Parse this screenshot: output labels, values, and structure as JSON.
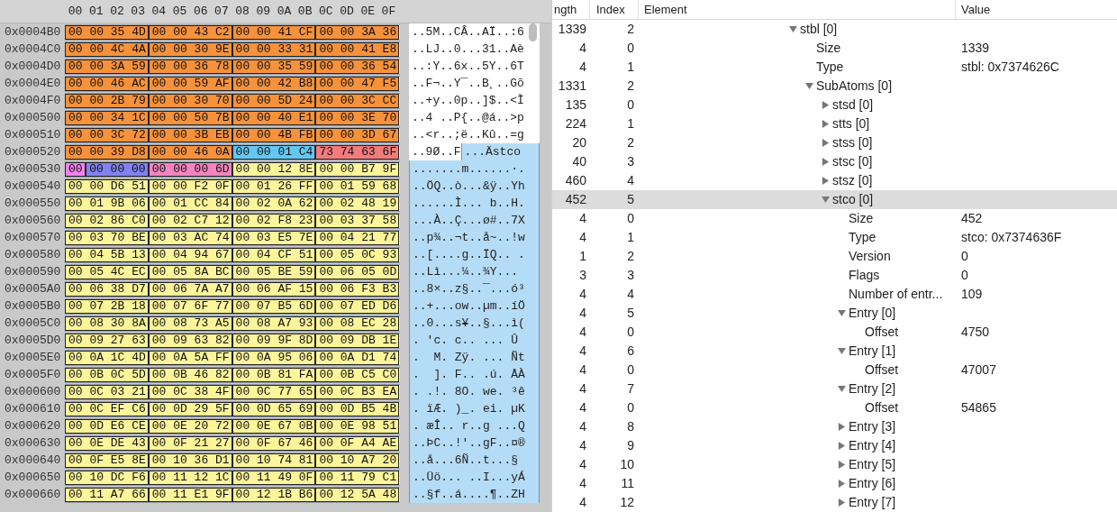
{
  "hex_view": {
    "columns": [
      "00",
      "01",
      "02",
      "03",
      "04",
      "05",
      "06",
      "07",
      "08",
      "09",
      "0A",
      "0B",
      "0C",
      "0D",
      "0E",
      "0F"
    ],
    "rows": [
      {
        "address": "0x0004B0",
        "segments": [
          {
            "bytes": "00 00 35 4D",
            "color": "#f7923a"
          },
          {
            "bytes": "00 00 43 C2",
            "color": "#f7923a"
          },
          {
            "bytes": "00 00 41 CF",
            "color": "#f7923a"
          },
          {
            "bytes": "00 00 3A 36",
            "color": "#f7923a"
          }
        ],
        "ascii": [
          {
            "text": "..5M..CÂ..AÏ..:6",
            "highlighted": false
          }
        ]
      },
      {
        "address": "0x0004C0",
        "segments": [
          {
            "bytes": "00 00 4C 4A",
            "color": "#f7923a"
          },
          {
            "bytes": "00 00 30 9E",
            "color": "#f7923a"
          },
          {
            "bytes": "00 00 33 31",
            "color": "#f7923a"
          },
          {
            "bytes": "00 00 41 E8",
            "color": "#f7923a"
          }
        ],
        "ascii": [
          {
            "text": "..LJ..0...31..Aè",
            "highlighted": false
          }
        ]
      },
      {
        "address": "0x0004D0",
        "segments": [
          {
            "bytes": "00 00 3A 59",
            "color": "#f7923a"
          },
          {
            "bytes": "00 00 36 78",
            "color": "#f7923a"
          },
          {
            "bytes": "00 00 35 59",
            "color": "#f7923a"
          },
          {
            "bytes": "00 00 36 54",
            "color": "#f7923a"
          }
        ],
        "ascii": [
          {
            "text": "..:Y..6x..5Y..6T",
            "highlighted": false
          }
        ]
      },
      {
        "address": "0x0004E0",
        "segments": [
          {
            "bytes": "00 00 46 AC",
            "color": "#f7923a"
          },
          {
            "bytes": "00 00 59 AF",
            "color": "#f7923a"
          },
          {
            "bytes": "00 00 42 B8",
            "color": "#f7923a"
          },
          {
            "bytes": "00 00 47 F5",
            "color": "#f7923a"
          }
        ],
        "ascii": [
          {
            "text": "..F¬..Y¯..B¸..Gõ",
            "highlighted": false
          }
        ]
      },
      {
        "address": "0x0004F0",
        "segments": [
          {
            "bytes": "00 00 2B 79",
            "color": "#f7923a"
          },
          {
            "bytes": "00 00 30 70",
            "color": "#f7923a"
          },
          {
            "bytes": "00 00 5D 24",
            "color": "#f7923a"
          },
          {
            "bytes": "00 00 3C CC",
            "color": "#f7923a"
          }
        ],
        "ascii": [
          {
            "text": "..+y..0p..]$..<Ì",
            "highlighted": false
          }
        ]
      },
      {
        "address": "0x000500",
        "segments": [
          {
            "bytes": "00 00 34 1C",
            "color": "#f7923a"
          },
          {
            "bytes": "00 00 50 7B",
            "color": "#f7923a"
          },
          {
            "bytes": "00 00 40 E1",
            "color": "#f7923a"
          },
          {
            "bytes": "00 00 3E 70",
            "color": "#f7923a"
          }
        ],
        "ascii": [
          {
            "text": "..4 ..P{..@á..>p",
            "highlighted": false
          }
        ]
      },
      {
        "address": "0x000510",
        "segments": [
          {
            "bytes": "00 00 3C 72",
            "color": "#f7923a"
          },
          {
            "bytes": "00 00 3B EB",
            "color": "#f7923a"
          },
          {
            "bytes": "00 00 4B FB",
            "color": "#f7923a"
          },
          {
            "bytes": "00 00 3D 67",
            "color": "#f7923a"
          }
        ],
        "ascii": [
          {
            "text": "..<r..;ë..Kû..=g",
            "highlighted": false
          }
        ]
      },
      {
        "address": "0x000520",
        "segments": [
          {
            "bytes": "00 00 39 D8",
            "color": "#f7923a"
          },
          {
            "bytes": "00 00 46 0A",
            "color": "#f7923a"
          },
          {
            "bytes": "00 00 01 C4",
            "color": "#62c8f3"
          },
          {
            "bytes": "73 74 63 6F",
            "color": "#f37b7d"
          }
        ],
        "ascii": [
          {
            "text": "..9Ø..F",
            "highlighted": false
          },
          {
            "text": "...Ästco",
            "highlighted": true
          }
        ]
      },
      {
        "address": "0x000530",
        "segments": [
          {
            "bytes": "00",
            "color": "#f383f0"
          },
          {
            "bytes": "00 00 00",
            "color": "#8282f0"
          },
          {
            "bytes": "00 00 00 6D",
            "color": "#f285c0"
          },
          {
            "bytes": "00 00 12 8E",
            "color": "#fdf59a"
          },
          {
            "bytes": "00 00 B7 9F",
            "color": "#fdf59a"
          }
        ],
        "ascii": [
          {
            "text": ".......m......·.",
            "highlighted": true
          }
        ]
      },
      {
        "address": "0x000540",
        "segments": [
          {
            "bytes": "00 00 D6 51",
            "color": "#fdf59a"
          },
          {
            "bytes": "00 00 F2 0F",
            "color": "#fdf59a"
          },
          {
            "bytes": "00 01 26 FF",
            "color": "#fdf59a"
          },
          {
            "bytes": "00 01 59 68",
            "color": "#fdf59a"
          }
        ],
        "ascii": [
          {
            "text": "..ÖQ..ò...&ÿ..Yh",
            "highlighted": true
          }
        ]
      },
      {
        "address": "0x000550",
        "segments": [
          {
            "bytes": "00 01 9B 06",
            "color": "#fdf59a"
          },
          {
            "bytes": "00 01 CC 84",
            "color": "#fdf59a"
          },
          {
            "bytes": "00 02 0A 62",
            "color": "#fdf59a"
          },
          {
            "bytes": "00 02 48 19",
            "color": "#fdf59a"
          }
        ],
        "ascii": [
          {
            "text": "......Ì... b..H.",
            "highlighted": true
          }
        ]
      },
      {
        "address": "0x000560",
        "segments": [
          {
            "bytes": "00 02 86 C0",
            "color": "#fdf59a"
          },
          {
            "bytes": "00 02 C7 12",
            "color": "#fdf59a"
          },
          {
            "bytes": "00 02 F8 23",
            "color": "#fdf59a"
          },
          {
            "bytes": "00 03 37 58",
            "color": "#fdf59a"
          }
        ],
        "ascii": [
          {
            "text": "...À..Ç...ø#..7X",
            "highlighted": true
          }
        ]
      },
      {
        "address": "0x000570",
        "segments": [
          {
            "bytes": "00 03 70 BE",
            "color": "#fdf59a"
          },
          {
            "bytes": "00 03 AC 74",
            "color": "#fdf59a"
          },
          {
            "bytes": "00 03 E5 7E",
            "color": "#fdf59a"
          },
          {
            "bytes": "00 04 21 77",
            "color": "#fdf59a"
          }
        ],
        "ascii": [
          {
            "text": "..p¾..¬t..å~..!w",
            "highlighted": true
          }
        ]
      },
      {
        "address": "0x000580",
        "segments": [
          {
            "bytes": "00 04 5B 13",
            "color": "#fdf59a"
          },
          {
            "bytes": "00 04 94 67",
            "color": "#fdf59a"
          },
          {
            "bytes": "00 04 CF 51",
            "color": "#fdf59a"
          },
          {
            "bytes": "00 05 0C 93",
            "color": "#fdf59a"
          }
        ],
        "ascii": [
          {
            "text": "..[....g..ÏQ.. .",
            "highlighted": true
          }
        ]
      },
      {
        "address": "0x000590",
        "segments": [
          {
            "bytes": "00 05 4C EC",
            "color": "#fdf59a"
          },
          {
            "bytes": "00 05 8A BC",
            "color": "#fdf59a"
          },
          {
            "bytes": "00 05 BE 59",
            "color": "#fdf59a"
          },
          {
            "bytes": "00 06 05 0D",
            "color": "#fdf59a"
          }
        ],
        "ascii": [
          {
            "text": "..Lì...¼..¾Y...",
            "highlighted": true
          }
        ]
      },
      {
        "address": "0x0005A0",
        "segments": [
          {
            "bytes": "00 06 38 D7",
            "color": "#fdf59a"
          },
          {
            "bytes": "00 06 7A A7",
            "color": "#fdf59a"
          },
          {
            "bytes": "00 06 AF 15",
            "color": "#fdf59a"
          },
          {
            "bytes": "00 06 F3 B3",
            "color": "#fdf59a"
          }
        ],
        "ascii": [
          {
            "text": "..8×..z§..¯...ó³",
            "highlighted": true
          }
        ]
      },
      {
        "address": "0x0005B0",
        "segments": [
          {
            "bytes": "00 07 2B 18",
            "color": "#fdf59a"
          },
          {
            "bytes": "00 07 6F 77",
            "color": "#fdf59a"
          },
          {
            "bytes": "00 07 B5 6D",
            "color": "#fdf59a"
          },
          {
            "bytes": "00 07 ED D6",
            "color": "#fdf59a"
          }
        ],
        "ascii": [
          {
            "text": "..+...ow..µm..íÖ",
            "highlighted": true
          }
        ]
      },
      {
        "address": "0x0005C0",
        "segments": [
          {
            "bytes": "00 08 30 8A",
            "color": "#fdf59a"
          },
          {
            "bytes": "00 08 73 A5",
            "color": "#fdf59a"
          },
          {
            "bytes": "00 08 A7 93",
            "color": "#fdf59a"
          },
          {
            "bytes": "00 08 EC 28",
            "color": "#fdf59a"
          }
        ],
        "ascii": [
          {
            "text": "..0...s¥..§...ì(",
            "highlighted": true
          }
        ]
      },
      {
        "address": "0x0005D0",
        "segments": [
          {
            "bytes": "00 09 27 63",
            "color": "#fdf59a"
          },
          {
            "bytes": "00 09 63 82",
            "color": "#fdf59a"
          },
          {
            "bytes": "00 09 9F 8D",
            "color": "#fdf59a"
          },
          {
            "bytes": "00 09 DB 1E",
            "color": "#fdf59a"
          }
        ],
        "ascii": [
          {
            "text": ". 'c. c.. ... Û",
            "highlighted": true
          }
        ]
      },
      {
        "address": "0x0005E0",
        "segments": [
          {
            "bytes": "00 0A 1C 4D",
            "color": "#fdf59a"
          },
          {
            "bytes": "00 0A 5A FF",
            "color": "#fdf59a"
          },
          {
            "bytes": "00 0A 95 06",
            "color": "#fdf59a"
          },
          {
            "bytes": "00 0A D1 74",
            "color": "#fdf59a"
          }
        ],
        "ascii": [
          {
            "text": ".  M. Zÿ. ... Ñt",
            "highlighted": true
          }
        ]
      },
      {
        "address": "0x0005F0",
        "segments": [
          {
            "bytes": "00 0B 0C 5D",
            "color": "#fdf59a"
          },
          {
            "bytes": "00 0B 46 82",
            "color": "#fdf59a"
          },
          {
            "bytes": "00 0B 81 FA",
            "color": "#fdf59a"
          },
          {
            "bytes": "00 0B C5 C0",
            "color": "#fdf59a"
          }
        ],
        "ascii": [
          {
            "text": ".  ]. F.. .ú. ÅÀ",
            "highlighted": true
          }
        ]
      },
      {
        "address": "0x000600",
        "segments": [
          {
            "bytes": "00 0C 03 21",
            "color": "#fdf59a"
          },
          {
            "bytes": "00 0C 38 4F",
            "color": "#fdf59a"
          },
          {
            "bytes": "00 0C 77 65",
            "color": "#fdf59a"
          },
          {
            "bytes": "00 0C B3 EA",
            "color": "#fdf59a"
          }
        ],
        "ascii": [
          {
            "text": ". .!. 8O. we. ³ê",
            "highlighted": true
          }
        ]
      },
      {
        "address": "0x000610",
        "segments": [
          {
            "bytes": "00 0C EF C6",
            "color": "#fdf59a"
          },
          {
            "bytes": "00 0D 29 5F",
            "color": "#fdf59a"
          },
          {
            "bytes": "00 0D 65 69",
            "color": "#fdf59a"
          },
          {
            "bytes": "00 0D B5 4B",
            "color": "#fdf59a"
          }
        ],
        "ascii": [
          {
            "text": ". ïÆ. )_. ei. µK",
            "highlighted": true
          }
        ]
      },
      {
        "address": "0x000620",
        "segments": [
          {
            "bytes": "00 0D E6 CE",
            "color": "#fdf59a"
          },
          {
            "bytes": "00 0E 20 72",
            "color": "#fdf59a"
          },
          {
            "bytes": "00 0E 67 0B",
            "color": "#fdf59a"
          },
          {
            "bytes": "00 0E 98 51",
            "color": "#fdf59a"
          }
        ],
        "ascii": [
          {
            "text": ". æÎ.. r..g ...Q",
            "highlighted": true
          }
        ]
      },
      {
        "address": "0x000630",
        "segments": [
          {
            "bytes": "00 0E DE 43",
            "color": "#fdf59a"
          },
          {
            "bytes": "00 0F 21 27",
            "color": "#fdf59a"
          },
          {
            "bytes": "00 0F 67 46",
            "color": "#fdf59a"
          },
          {
            "bytes": "00 0F A4 AE",
            "color": "#fdf59a"
          }
        ],
        "ascii": [
          {
            "text": "..ÞC..!'..gF..¤®",
            "highlighted": true
          }
        ]
      },
      {
        "address": "0x000640",
        "segments": [
          {
            "bytes": "00 0F E5 8E",
            "color": "#fdf59a"
          },
          {
            "bytes": "00 10 36 D1",
            "color": "#fdf59a"
          },
          {
            "bytes": "00 10 74 81",
            "color": "#fdf59a"
          },
          {
            "bytes": "00 10 A7 20",
            "color": "#fdf59a"
          }
        ],
        "ascii": [
          {
            "text": "..å...6Ñ..t...§",
            "highlighted": true
          }
        ]
      },
      {
        "address": "0x000650",
        "segments": [
          {
            "bytes": "00 10 DC F6",
            "color": "#fdf59a"
          },
          {
            "bytes": "00 11 12 1C",
            "color": "#fdf59a"
          },
          {
            "bytes": "00 11 49 0F",
            "color": "#fdf59a"
          },
          {
            "bytes": "00 11 79 C1",
            "color": "#fdf59a"
          }
        ],
        "ascii": [
          {
            "text": "..Üö... ..I...yÁ",
            "highlighted": true
          }
        ]
      },
      {
        "address": "0x000660",
        "segments": [
          {
            "bytes": "00 11 A7 66",
            "color": "#fdf59a"
          },
          {
            "bytes": "00 11 E1 9F",
            "color": "#fdf59a"
          },
          {
            "bytes": "00 12 1B B6",
            "color": "#fdf59a"
          },
          {
            "bytes": "00 12 5A 48",
            "color": "#fdf59a"
          }
        ],
        "ascii": [
          {
            "text": "..§f..á....¶..ZH",
            "highlighted": true
          }
        ]
      }
    ]
  },
  "structure_view": {
    "columns": [
      "ngth",
      "Index",
      "Element",
      "Value"
    ],
    "tree": [
      {
        "length": "1339",
        "index": "2",
        "label": "stbl [0]",
        "expanded": true,
        "selected": false,
        "children": [
          {
            "length": "4",
            "index": "0",
            "label": "Size",
            "value": "1339",
            "selected": false
          },
          {
            "length": "4",
            "index": "1",
            "label": "Type",
            "value": "stbl: 0x7374626C",
            "selected": false
          },
          {
            "length": "1331",
            "index": "2",
            "label": "SubAtoms [0]",
            "expanded": true,
            "selected": false,
            "children": [
              {
                "length": "135",
                "index": "0",
                "label": "stsd [0]",
                "expanded": false,
                "selected": false
              },
              {
                "length": "224",
                "index": "1",
                "label": "stts [0]",
                "expanded": false,
                "selected": false
              },
              {
                "length": "20",
                "index": "2",
                "label": "stss [0]",
                "expanded": false,
                "selected": false
              },
              {
                "length": "40",
                "index": "3",
                "label": "stsc [0]",
                "expanded": false,
                "selected": false
              },
              {
                "length": "460",
                "index": "4",
                "label": "stsz [0]",
                "expanded": false,
                "selected": false
              },
              {
                "length": "452",
                "index": "5",
                "label": "stco [0]",
                "expanded": true,
                "selected": true,
                "children": [
                  {
                    "length": "4",
                    "index": "0",
                    "label": "Size",
                    "value": "452",
                    "selected": false
                  },
                  {
                    "length": "4",
                    "index": "1",
                    "label": "Type",
                    "value": "stco: 0x7374636F",
                    "selected": false
                  },
                  {
                    "length": "1",
                    "index": "2",
                    "label": "Version",
                    "value": "0",
                    "selected": false
                  },
                  {
                    "length": "3",
                    "index": "3",
                    "label": "Flags",
                    "value": "0",
                    "selected": false
                  },
                  {
                    "length": "4",
                    "index": "4",
                    "label": "Number of entr...",
                    "value": "109",
                    "selected": false
                  },
                  {
                    "length": "4",
                    "index": "5",
                    "label": "Entry [0]",
                    "expanded": true,
                    "selected": false,
                    "children": [
                      {
                        "length": "4",
                        "index": "0",
                        "label": "Offset",
                        "value": "4750",
                        "selected": false
                      }
                    ]
                  },
                  {
                    "length": "4",
                    "index": "6",
                    "label": "Entry [1]",
                    "expanded": true,
                    "selected": false,
                    "children": [
                      {
                        "length": "4",
                        "index": "0",
                        "label": "Offset",
                        "value": "47007",
                        "selected": false
                      }
                    ]
                  },
                  {
                    "length": "4",
                    "index": "7",
                    "label": "Entry [2]",
                    "expanded": true,
                    "selected": false,
                    "children": [
                      {
                        "length": "4",
                        "index": "0",
                        "label": "Offset",
                        "value": "54865",
                        "selected": false
                      }
                    ]
                  },
                  {
                    "length": "4",
                    "index": "8",
                    "label": "Entry [3]",
                    "expanded": false,
                    "selected": false
                  },
                  {
                    "length": "4",
                    "index": "9",
                    "label": "Entry [4]",
                    "expanded": false,
                    "selected": false
                  },
                  {
                    "length": "4",
                    "index": "10",
                    "label": "Entry [5]",
                    "expanded": false,
                    "selected": false
                  },
                  {
                    "length": "4",
                    "index": "11",
                    "label": "Entry [6]",
                    "expanded": false,
                    "selected": false
                  },
                  {
                    "length": "4",
                    "index": "12",
                    "label": "Entry [7]",
                    "expanded": false,
                    "selected": false
                  }
                ]
              }
            ]
          }
        ]
      }
    ]
  }
}
